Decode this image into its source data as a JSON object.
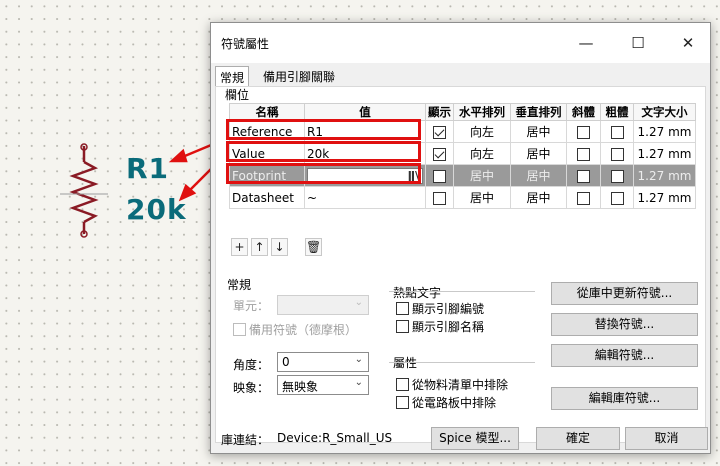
{
  "schematic": {
    "reference": "R1",
    "value": "20k",
    "wire_color": "#8a1a24",
    "text_color": "#0a6b7a",
    "annotation_color": "#e01010"
  },
  "dialog": {
    "title": "符號屬性",
    "window_controls": [
      "minimize-icon",
      "maximize-icon",
      "close-icon"
    ],
    "tabs": [
      {
        "label": "常規",
        "active": true
      },
      {
        "label": "備用引腳關聯",
        "active": false
      }
    ],
    "fields": {
      "group_label": "欄位",
      "headers": [
        "名稱",
        "值",
        "顯示",
        "水平排列",
        "垂直排列",
        "斜體",
        "粗體",
        "文字大小"
      ],
      "rows": [
        {
          "name": "Reference",
          "value": "R1",
          "show": true,
          "h_align": "向左",
          "v_align": "居中",
          "italic": false,
          "bold": false,
          "size": "1.27 mm",
          "selected": false
        },
        {
          "name": "Value",
          "value": "20k",
          "show": true,
          "h_align": "向左",
          "v_align": "居中",
          "italic": false,
          "bold": false,
          "size": "1.27 mm",
          "selected": false
        },
        {
          "name": "Footprint",
          "value": "",
          "show": false,
          "h_align": "居中",
          "v_align": "居中",
          "italic": false,
          "bold": false,
          "size": "1.27 mm",
          "selected": true
        },
        {
          "name": "Datasheet",
          "value": "~",
          "show": false,
          "h_align": "居中",
          "v_align": "居中",
          "italic": false,
          "bold": false,
          "size": "1.27 mm",
          "selected": false
        }
      ],
      "toolbar_icons": [
        "add-icon",
        "move-up-icon",
        "move-down-icon",
        "delete-icon"
      ]
    },
    "general": {
      "group_label": "常規",
      "unit_label": "單元：",
      "alt_symbol_label": "備用符號（德摩根）",
      "angle_label": "角度：",
      "angle_value": "0",
      "mirror_label": "映象：",
      "mirror_value": "無映象"
    },
    "hotkey_text": {
      "group_label": "熱點文字",
      "show_pin_numbers": "顯示引腳編號",
      "show_pin_names": "顯示引腳名稱"
    },
    "attributes": {
      "group_label": "屬性",
      "exclude_bom": "從物料清單中排除",
      "exclude_board": "從電路板中排除"
    },
    "actions": {
      "update_from_lib": "從庫中更新符號...",
      "swap_symbol": "替換符號...",
      "edit_symbol": "編輯符號...",
      "edit_lib_symbol": "編輯庫符號..."
    },
    "footer": {
      "lib_link_label": "庫連結：",
      "lib_link_value": "Device:R_Small_US",
      "spice_model": "Spice 模型...",
      "ok": "確定",
      "cancel": "取消"
    }
  }
}
